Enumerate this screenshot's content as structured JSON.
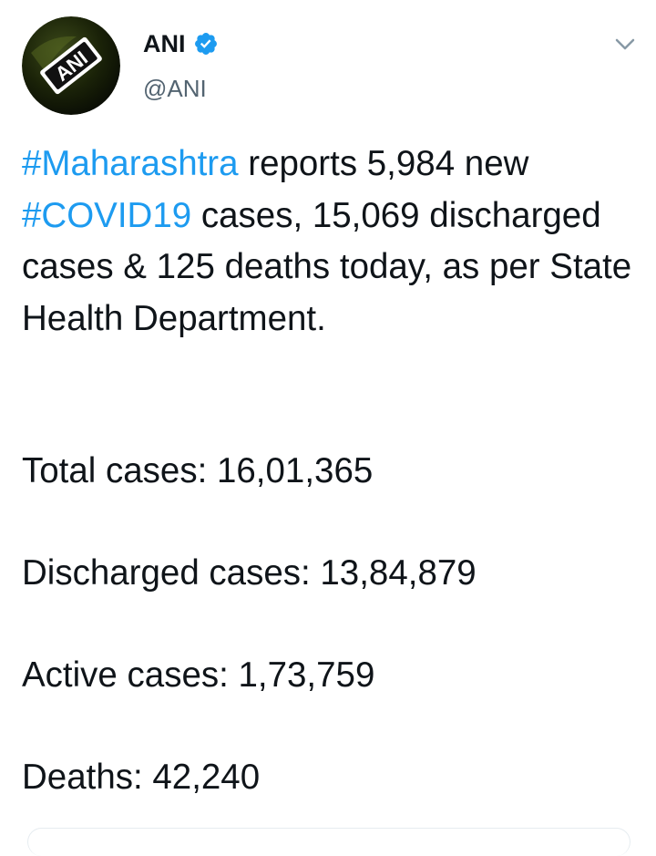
{
  "author": {
    "display_name": "ANI",
    "handle": "@ANI",
    "avatar_text": "ANI",
    "verified_icon": "verified-badge-icon",
    "menu_icon": "chevron-down-icon"
  },
  "tweet": {
    "intro": {
      "tag1": "#Maharashtra",
      "text1": " reports 5,984 new ",
      "tag2": "#COVID19",
      "text2": " cases, 15,069 discharged cases & 125 deaths today, as per State Health Department."
    },
    "stats": [
      "Total cases: 16,01,365",
      "Discharged cases: 13,84,879",
      "Active cases: 1,73,759",
      "Deaths: 42,240"
    ]
  },
  "colors": {
    "hashtag": "#1d9bf0",
    "text": "#0f1419",
    "muted": "#536471",
    "verified": "#1d9bf0"
  }
}
